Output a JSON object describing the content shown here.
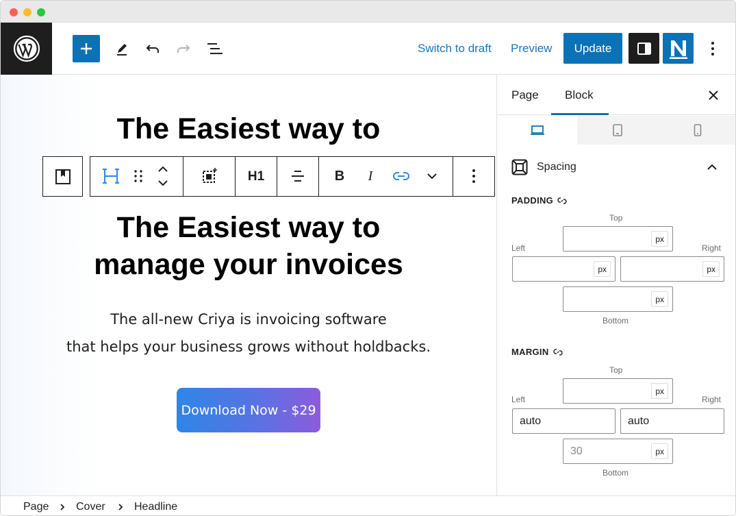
{
  "topbar": {
    "switch_to_draft": "Switch to draft",
    "preview": "Preview",
    "update": "Update"
  },
  "canvas": {
    "ghost_headline": "The Easiest way to",
    "headline_line1": "The Easiest way to",
    "headline_line2": "manage your invoices",
    "sub_line1": "The all-new Criya is invoicing software",
    "sub_line2": "that helps your business grows without holdbacks.",
    "cta": "Download Now - $29"
  },
  "block_toolbar": {
    "heading_level": "H1"
  },
  "sidebar": {
    "tabs": [
      "Page",
      "Block"
    ],
    "active_tab": "Block",
    "panel_title": "Spacing",
    "padding": {
      "label": "PADDING",
      "top_label": "Top",
      "left_label": "Left",
      "right_label": "Right",
      "bottom_label": "Bottom",
      "top_value": "",
      "left_value": "",
      "right_value": "",
      "bottom_value": "",
      "unit": "px"
    },
    "margin": {
      "label": "MARGIN",
      "top_label": "Top",
      "left_label": "Left",
      "right_label": "Right",
      "bottom_label": "Bottom",
      "top_value": "",
      "left_value": "auto",
      "right_value": "auto",
      "bottom_placeholder": "30",
      "unit": "px"
    }
  },
  "footer": {
    "breadcrumbs": [
      "Page",
      "Cover",
      "Headline"
    ]
  },
  "colors": {
    "accent": "#0a72b5",
    "dark": "#1e1e1e",
    "cta_gradient_start": "#2f86e6",
    "cta_gradient_end": "#8d5bdc"
  }
}
